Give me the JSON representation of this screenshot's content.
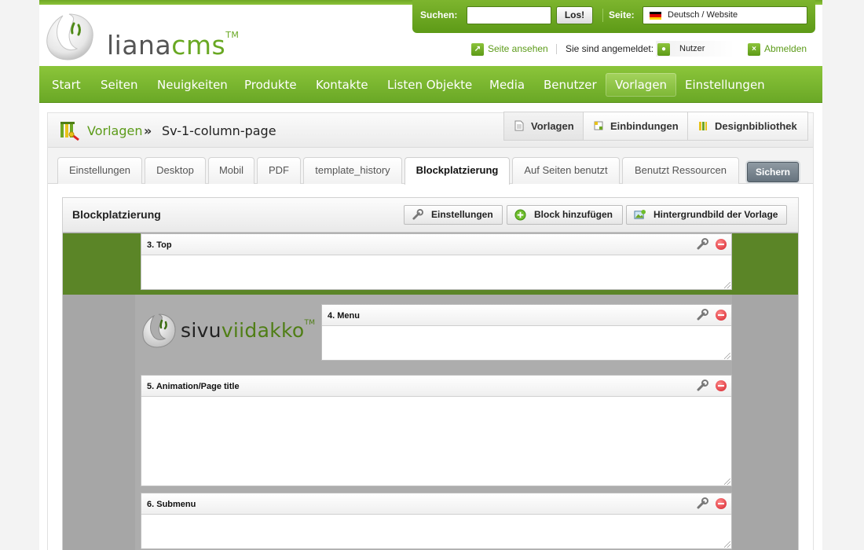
{
  "header": {
    "logo_text_a": "liana",
    "logo_text_b": "cms",
    "logo_tm": "TM",
    "search_label": "Suchen:",
    "search_value": "",
    "search_button": "Los!",
    "site_label": "Seite:",
    "site_value": "Deutsch / Website",
    "view_site": "Seite ansehen",
    "logged_in_label": "Sie sind angemeldet:",
    "user_name": "Nutzer",
    "logout": "Abmelden"
  },
  "nav": {
    "items": [
      "Start",
      "Seiten",
      "Neuigkeiten",
      "Produkte",
      "Kontakte",
      "Listen Objekte",
      "Media",
      "Benutzer",
      "Vorlagen",
      "Einstellungen"
    ],
    "active": "Vorlagen"
  },
  "breadcrumb": {
    "root": "Vorlagen",
    "separator": "»",
    "current": "Sv-1-column-page"
  },
  "subtabs": [
    "Vorlagen",
    "Einbindungen",
    "Designbibliothek"
  ],
  "tabs": {
    "items": [
      "Einstellungen",
      "Desktop",
      "Mobil",
      "PDF",
      "template_history",
      "Blockplatzierung",
      "Auf Seiten benutzt",
      "Benutzt Ressourcen"
    ],
    "active": "Blockplatzierung",
    "save_button": "Sichern"
  },
  "block_placement": {
    "title": "Blockplatzierung",
    "buttons": [
      "Einstellungen",
      "Block hinzufügen",
      "Hintergrundbild der Vorlage"
    ],
    "blocks": [
      "3. Top",
      "4. Menu",
      "5. Animation/Page title",
      "6. Submenu"
    ]
  },
  "template_logo": {
    "text_a": "sivu",
    "text_b": "viidakko",
    "tm": "TM"
  },
  "colors": {
    "brand_green": "#6aa826",
    "template_green": "#5b8527",
    "template_grey": "#a6a6a6",
    "save_button": "#66737e"
  }
}
